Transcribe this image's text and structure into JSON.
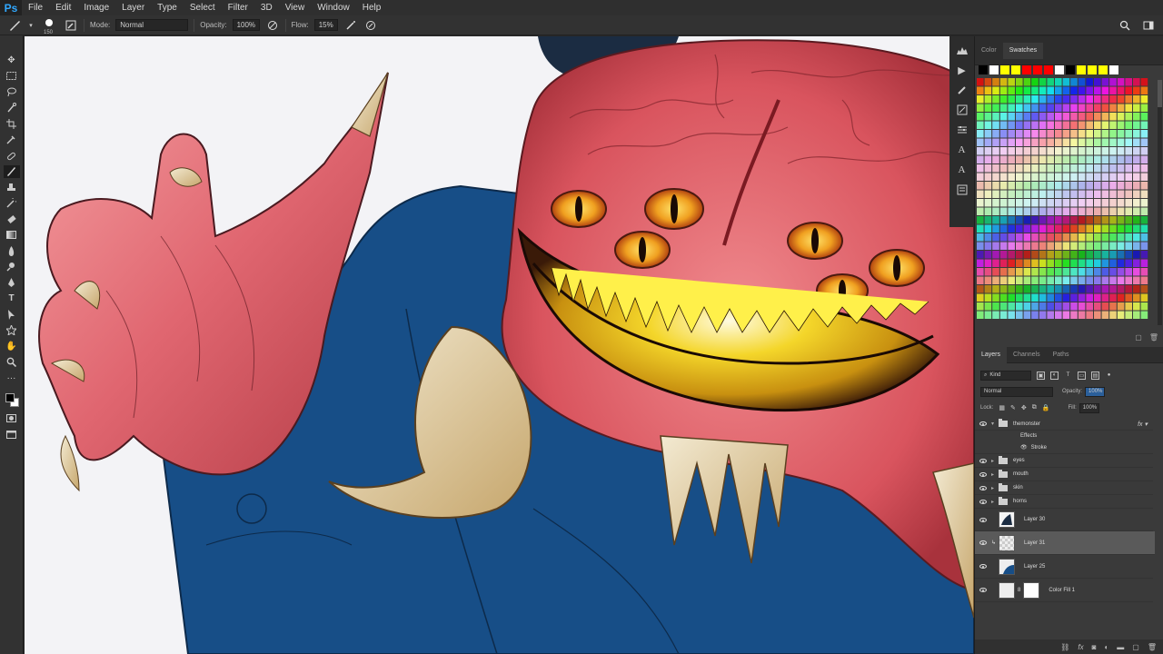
{
  "app": {
    "logo": "Ps"
  },
  "menu": [
    "File",
    "Edit",
    "Image",
    "Layer",
    "Type",
    "Select",
    "Filter",
    "3D",
    "View",
    "Window",
    "Help"
  ],
  "options": {
    "brush_size": "150",
    "mode_label": "Mode:",
    "mode_value": "Normal",
    "opacity_label": "Opacity:",
    "opacity_value": "100%",
    "flow_label": "Flow:",
    "flow_value": "15%"
  },
  "colors": {
    "foreground": "#000000",
    "background": "#ffffff",
    "accent": "#31a8ff"
  },
  "swatches_panel": {
    "tabs": [
      "Color",
      "Swatches"
    ],
    "active_tab": "Swatches"
  },
  "layers_panel": {
    "tabs": [
      "Layers",
      "Channels",
      "Paths"
    ],
    "active_tab": "Layers",
    "filter_kind": "Kind",
    "blend_mode": "Normal",
    "opacity_label": "Opacity:",
    "opacity_value": "100%",
    "lock_label": "Lock:",
    "fill_label": "Fill:",
    "fill_value": "100%",
    "layers": [
      {
        "name": "themonster",
        "type": "group",
        "fx": true
      },
      {
        "name": "Effects",
        "type": "effects"
      },
      {
        "name": "Stroke",
        "type": "effect"
      },
      {
        "name": "eyes",
        "type": "group"
      },
      {
        "name": "mouth",
        "type": "group"
      },
      {
        "name": "skin",
        "type": "group"
      },
      {
        "name": "horns",
        "type": "group"
      },
      {
        "name": "Layer 30",
        "type": "layer"
      },
      {
        "name": "Layer 31",
        "type": "layer",
        "selected": true
      },
      {
        "name": "Layer 25",
        "type": "layer"
      },
      {
        "name": "Color Fill 1",
        "type": "fill"
      }
    ]
  }
}
